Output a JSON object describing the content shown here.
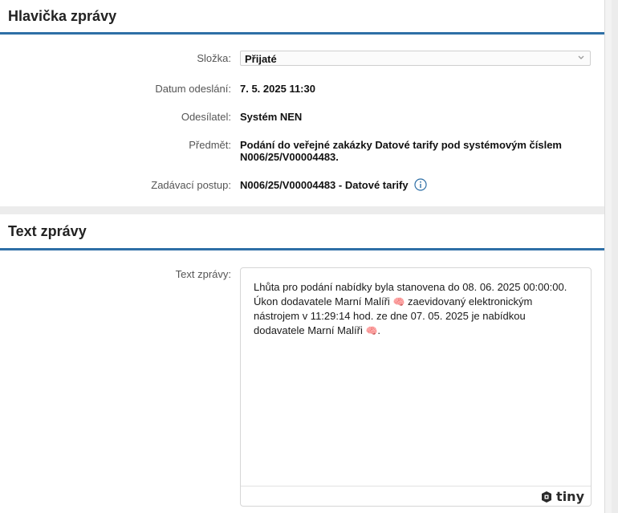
{
  "header_section": {
    "title": "Hlavička zprávy",
    "folder": {
      "label": "Složka:",
      "value": "Přijaté"
    },
    "sent_date": {
      "label": "Datum odeslání:",
      "value": "7. 5. 2025 11:30"
    },
    "sender": {
      "label": "Odesílatel:",
      "value": "Systém NEN"
    },
    "subject": {
      "label": "Předmět:",
      "line1": "Podání do veřejné zakázky Datové tarify pod systémovým číslem",
      "line2": "N006/25/V00004483."
    },
    "procedure": {
      "label": "Zadávací postup:",
      "value": "N006/25/V00004483 - Datové tarify"
    }
  },
  "text_section": {
    "title": "Text zprávy",
    "label": "Text zprávy:",
    "body": {
      "line1": "Lhůta pro podání nabídky byla stanovena do 08. 06. 2025 00:00:00.",
      "line2a": "Úkon dodavatele Marní Malíři",
      "line2b": "zaevidovaný elektronickým",
      "line3": "nástrojem v 11:29:14 hod. ze dne 07. 05. 2025 je nabídkou",
      "line4a": "dodavatele Marní Malíři",
      "line4b": ".",
      "emoji": "🧠"
    },
    "editor_brand": "tiny"
  },
  "colors": {
    "accent": "#2e6fa6",
    "background": "#ececec",
    "panel": "#ffffff"
  },
  "icons": [
    "chevron-down-icon",
    "info-icon",
    "tiny-logo-icon"
  ]
}
